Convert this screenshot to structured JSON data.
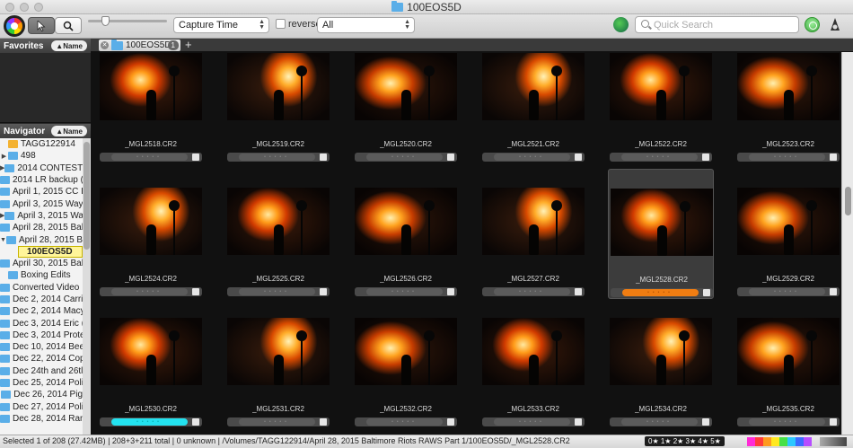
{
  "window": {
    "title": "100EOS5D"
  },
  "toolbar": {
    "sort_select": "Capture Time",
    "reverse_label": "reverse",
    "filter_select": "All",
    "search_placeholder": "Quick Search"
  },
  "left": {
    "favorites_title": "Favorites",
    "navigator_title": "Navigator",
    "sort_button": "▲Name",
    "tree": [
      {
        "label": "TAGG122914",
        "disclosure": "",
        "type": "root"
      },
      {
        "label": "498",
        "disclosure": "▶",
        "type": "folder"
      },
      {
        "label": "2014 CONTEST F",
        "disclosure": "▶",
        "type": "folder"
      },
      {
        "label": "2014 LR backup (",
        "disclosure": "",
        "type": "folder"
      },
      {
        "label": "April 1, 2015 CC I",
        "disclosure": "",
        "type": "folder"
      },
      {
        "label": "April 3, 2015 Way",
        "disclosure": "",
        "type": "folder"
      },
      {
        "label": "April 3, 2015 Way",
        "disclosure": "▶",
        "type": "folder"
      },
      {
        "label": "April 28, 2015 Bal",
        "disclosure": "",
        "type": "folder"
      },
      {
        "label": "April 28, 2015 Bal",
        "disclosure": "▼",
        "type": "folder"
      },
      {
        "label": "100EOS5D",
        "disclosure": "",
        "type": "selected"
      },
      {
        "label": "April 30, 2015 Bal",
        "disclosure": "",
        "type": "folder"
      },
      {
        "label": "Boxing Edits",
        "disclosure": "",
        "type": "folder"
      },
      {
        "label": "Converted Video I",
        "disclosure": "",
        "type": "folder"
      },
      {
        "label": "Dec 2, 2014 Carri",
        "disclosure": "",
        "type": "folder"
      },
      {
        "label": "Dec 2, 2014 Macy",
        "disclosure": "",
        "type": "folder"
      },
      {
        "label": "Dec 3, 2014 Eric (",
        "disclosure": "",
        "type": "folder"
      },
      {
        "label": "Dec 3, 2014 Prote",
        "disclosure": "",
        "type": "folder"
      },
      {
        "label": "Dec 10, 2014 Bee",
        "disclosure": "",
        "type": "folder"
      },
      {
        "label": "Dec 22, 2014 Cop",
        "disclosure": "",
        "type": "folder"
      },
      {
        "label": "Dec 24th and 26tl",
        "disclosure": "",
        "type": "folder"
      },
      {
        "label": "Dec 25, 2014 Poli",
        "disclosure": "",
        "type": "folder"
      },
      {
        "label": "Dec 26, 2014 Pig",
        "disclosure": "",
        "type": "folder"
      },
      {
        "label": "Dec 27, 2014 Poli",
        "disclosure": "",
        "type": "folder"
      },
      {
        "label": "Dec 28, 2014 Ran",
        "disclosure": "",
        "type": "folder"
      }
    ]
  },
  "tabs": [
    {
      "label": "100EOS5D",
      "count": "1"
    }
  ],
  "grid": {
    "items": [
      {
        "name": "_MGL2518.CR2",
        "label_color": "",
        "selected": false,
        "v": "a"
      },
      {
        "name": "_MGL2519.CR2",
        "label_color": "",
        "selected": false,
        "v": "b"
      },
      {
        "name": "_MGL2520.CR2",
        "label_color": "",
        "selected": false,
        "v": "c"
      },
      {
        "name": "_MGL2521.CR2",
        "label_color": "",
        "selected": false,
        "v": "b"
      },
      {
        "name": "_MGL2522.CR2",
        "label_color": "",
        "selected": false,
        "v": "a"
      },
      {
        "name": "_MGL2523.CR2",
        "label_color": "",
        "selected": false,
        "v": "c"
      },
      {
        "name": "_MGL2524.CR2",
        "label_color": "",
        "selected": false,
        "v": "b"
      },
      {
        "name": "_MGL2525.CR2",
        "label_color": "",
        "selected": false,
        "v": "a"
      },
      {
        "name": "_MGL2526.CR2",
        "label_color": "",
        "selected": false,
        "v": "c"
      },
      {
        "name": "_MGL2527.CR2",
        "label_color": "",
        "selected": false,
        "v": "b"
      },
      {
        "name": "_MGL2528.CR2",
        "label_color": "orange",
        "selected": true,
        "v": "a"
      },
      {
        "name": "_MGL2529.CR2",
        "label_color": "",
        "selected": false,
        "v": "c"
      },
      {
        "name": "_MGL2530.CR2",
        "label_color": "cyan",
        "selected": false,
        "v": "a"
      },
      {
        "name": "_MGL2531.CR2",
        "label_color": "",
        "selected": false,
        "v": "b"
      },
      {
        "name": "_MGL2532.CR2",
        "label_color": "",
        "selected": false,
        "v": "c"
      },
      {
        "name": "_MGL2533.CR2",
        "label_color": "",
        "selected": false,
        "v": "a"
      },
      {
        "name": "_MGL2534.CR2",
        "label_color": "",
        "selected": false,
        "v": "b"
      },
      {
        "name": "_MGL2535.CR2",
        "label_color": "",
        "selected": false,
        "v": "c"
      }
    ]
  },
  "status": {
    "text": "Selected 1 of 208 (27.42MB) | 208+3+211 total | 0 unknown | /Volumes/TAGG122914/April 28, 2015 Baltimore Riots RAWS  Part 1/100EOS5D/_MGL2528.CR2",
    "stars": "0★ 1★ 2★ 3★ 4★ 5★",
    "color_labels": [
      "#ff2bd6",
      "#ff3b3b",
      "#ff9a1f",
      "#ffe81f",
      "#46e046",
      "#2bc8ff",
      "#3b6bff",
      "#b64dff"
    ]
  },
  "colors": {
    "orange_label": "#f07d12",
    "cyan_label": "#23e2ef"
  }
}
